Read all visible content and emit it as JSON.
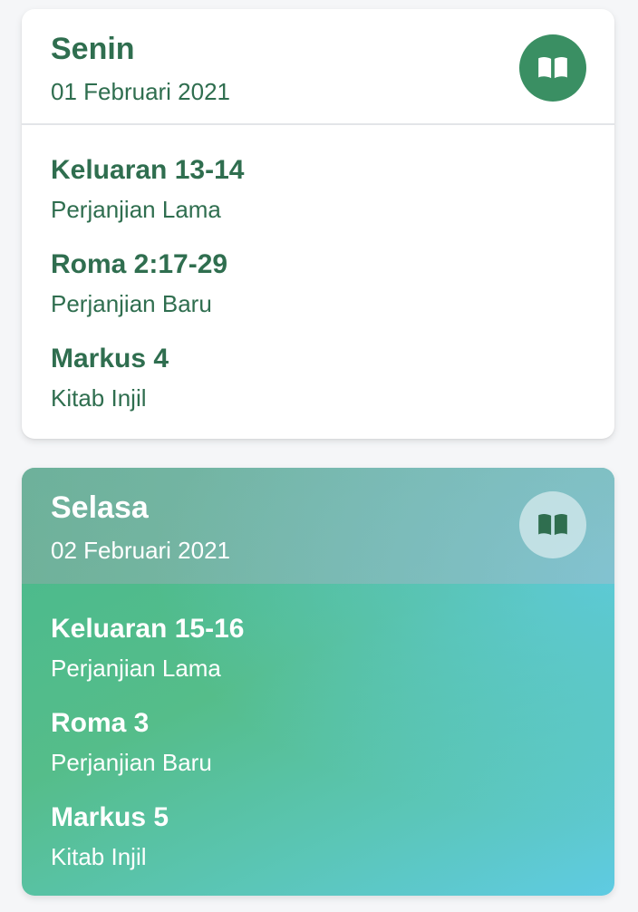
{
  "colors": {
    "primary_green": "#2f6e4f",
    "badge_green": "#3a8f63",
    "card_bg": "#ffffff",
    "gradient_start": "#48b98e",
    "gradient_end": "#5fcbe3"
  },
  "days": [
    {
      "day": "Senin",
      "date": "01 Februari 2021",
      "icon": "open-book-icon",
      "readings": [
        {
          "ref": "Keluaran 13-14",
          "book": "Perjanjian Lama"
        },
        {
          "ref": "Roma 2:17-29",
          "book": "Perjanjian Baru"
        },
        {
          "ref": "Markus 4",
          "book": "Kitab Injil"
        }
      ]
    },
    {
      "day": "Selasa",
      "date": "02 Februari 2021",
      "icon": "open-book-icon",
      "readings": [
        {
          "ref": "Keluaran 15-16",
          "book": "Perjanjian Lama"
        },
        {
          "ref": "Roma 3",
          "book": "Perjanjian Baru"
        },
        {
          "ref": "Markus 5",
          "book": "Kitab Injil"
        }
      ]
    }
  ]
}
